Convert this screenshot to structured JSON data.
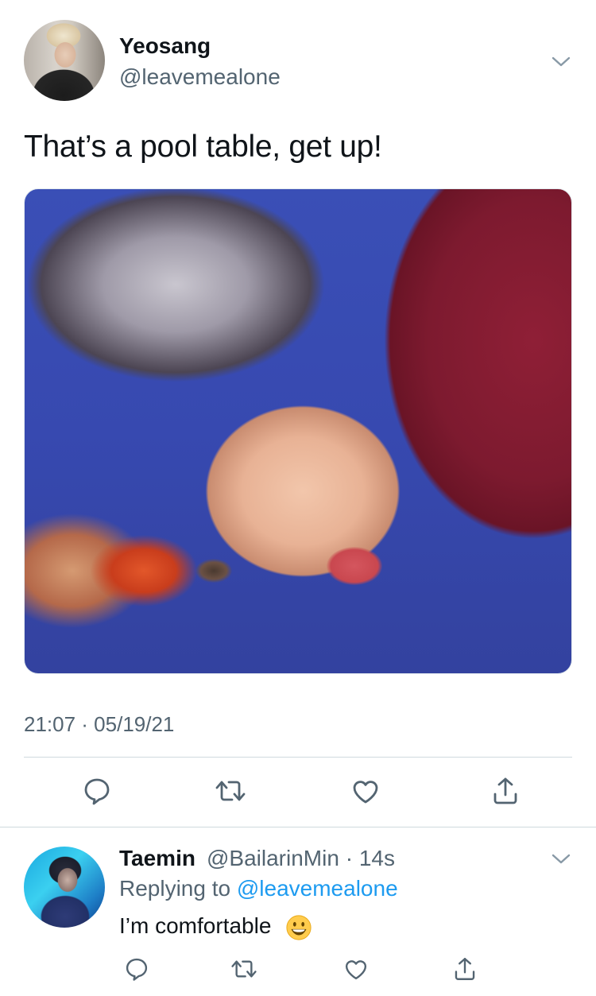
{
  "tweet": {
    "author": {
      "name": "Yeosang",
      "handle": "@leavemealone"
    },
    "text": "That’s a pool table, get up!",
    "timestamp": "21:07 · 05/19/21"
  },
  "reply": {
    "author": {
      "name": "Taemin",
      "handle": "@BailarinMin",
      "age": "14s"
    },
    "replying_label": "Replying to",
    "replying_to": "@leavemealone",
    "text": "I’m comfortable"
  },
  "icons": {
    "more": "chevron-down-icon",
    "reply": "comment-icon",
    "retweet": "retweet-icon",
    "like": "heart-icon",
    "share": "share-icon",
    "emoji": "grinning-face-emoji"
  },
  "colors": {
    "text": "#0f1419",
    "muted": "#536471",
    "link": "#1d9bf0",
    "divider": "#cfd9de"
  }
}
